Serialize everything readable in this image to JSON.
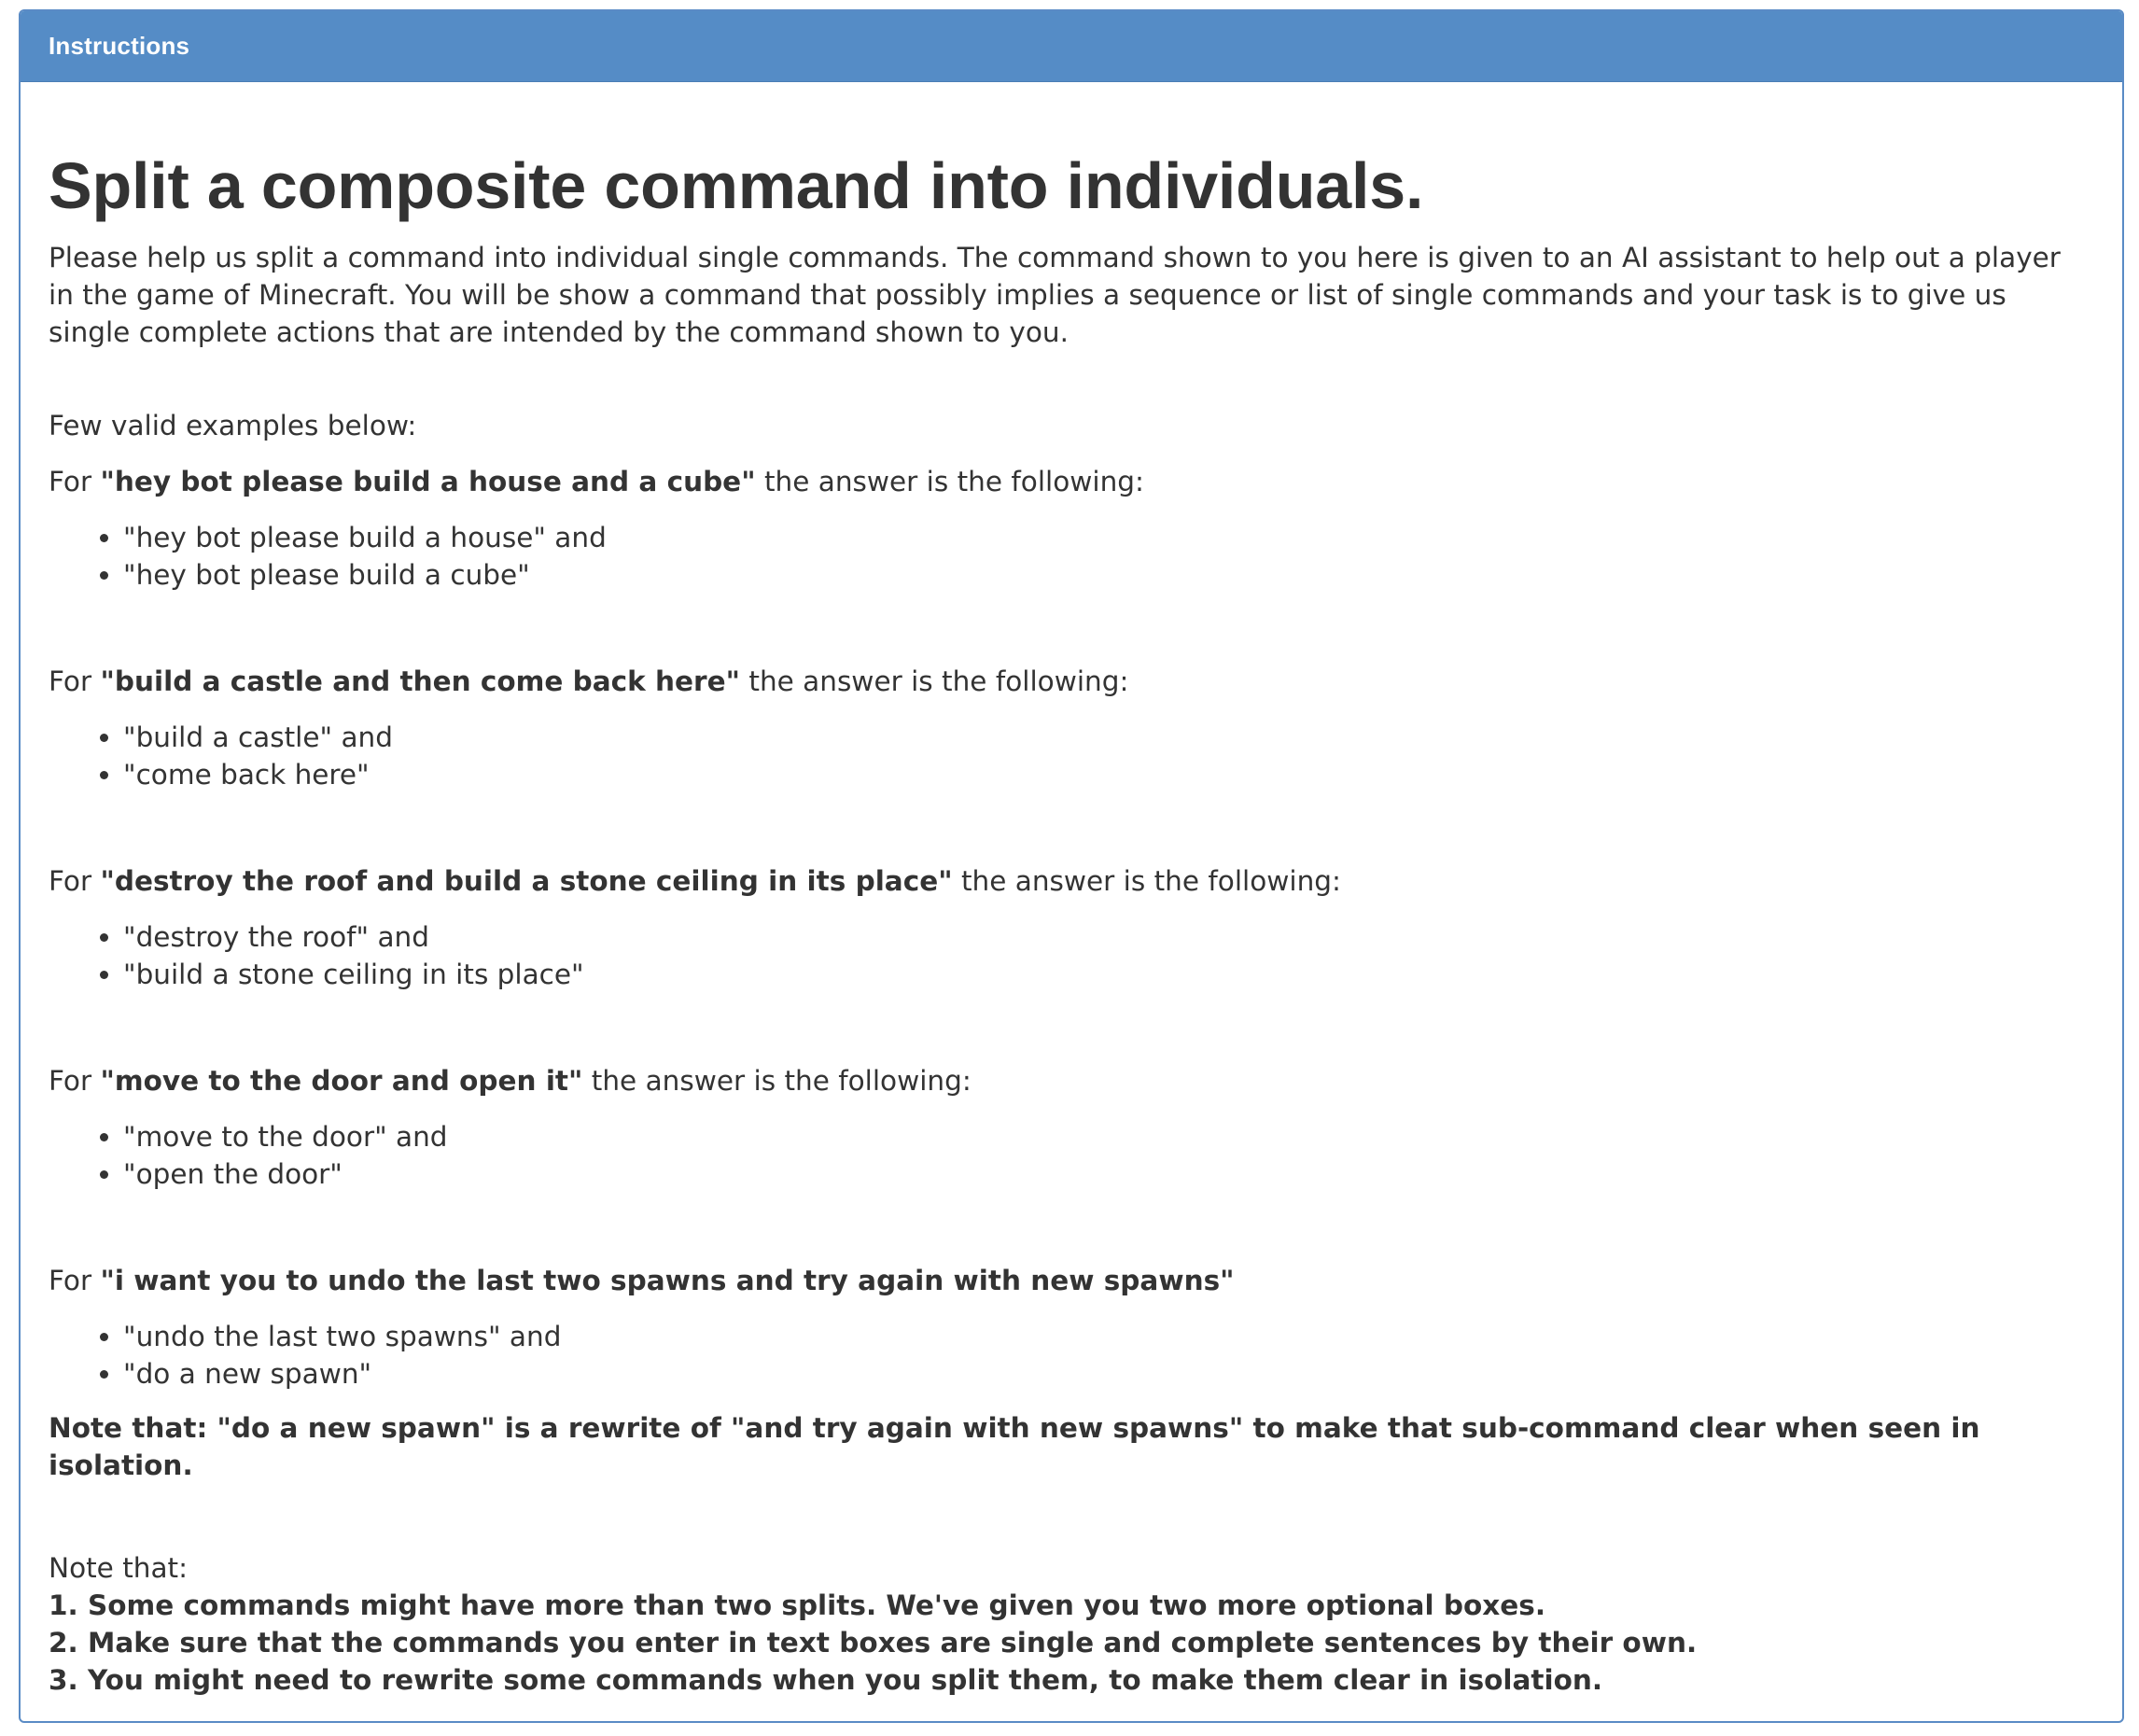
{
  "panel": {
    "heading": "Instructions"
  },
  "main": {
    "title": "Split a composite command into individuals.",
    "intro": "Please help us split a command into individual single commands. The command shown to you here is given to an AI assistant to help out a player in the game of Minecraft. You will be show a command that possibly implies a sequence or list of single commands and your task is to give us single complete actions that are intended by the command shown to you.",
    "examples_label": "Few valid examples below:",
    "examples": [
      {
        "prefix": "For ",
        "command": "\"hey bot please build a house and a cube\"",
        "suffix": " the answer is the following:",
        "items": [
          "\"hey bot please build a house\" and",
          "\"hey bot please build a cube\""
        ]
      },
      {
        "prefix": "For ",
        "command": "\"build a castle and then come back here\"",
        "suffix": " the answer is the following:",
        "items": [
          "\"build a castle\" and",
          "\"come back here\""
        ]
      },
      {
        "prefix": "For ",
        "command": "\"destroy the roof and build a stone ceiling in its place\"",
        "suffix": " the answer is the following:",
        "items": [
          "\"destroy the roof\" and",
          "\"build a stone ceiling in its place\""
        ]
      },
      {
        "prefix": "For ",
        "command": "\"move to the door and open it\"",
        "suffix": " the answer is the following:",
        "items": [
          "\"move to the door\" and",
          "\"open the door\""
        ]
      },
      {
        "prefix": "For ",
        "command": "\"i want you to undo the last two spawns and try again with new spawns\"",
        "suffix": "",
        "items": [
          "\"undo the last two spawns\" and",
          "\"do a new spawn\""
        ]
      }
    ],
    "example_note": "Note that: \"do a new spawn\" is a rewrite of \"and try again with new spawns\" to make that sub-command clear when seen in isolation.",
    "final_note_label": "Note that:",
    "final_notes": [
      "1. Some commands might have more than two splits. We've given you two more optional boxes.",
      "2. Make sure that the commands you enter in text boxes are single and complete sentences by their own.",
      "3. You might need to rewrite some commands when you split them, to make them clear in isolation."
    ]
  }
}
